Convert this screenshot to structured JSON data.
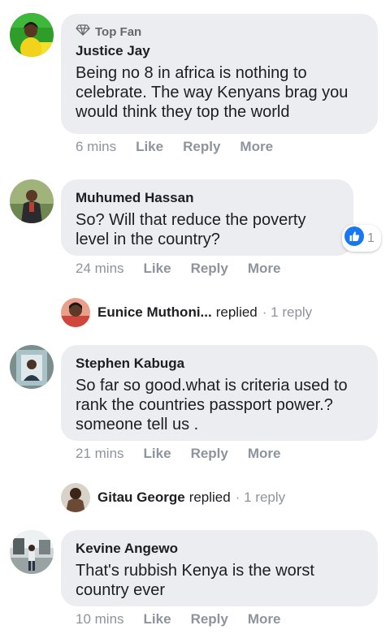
{
  "comments": [
    {
      "badge": "Top Fan",
      "name": "Justice Jay",
      "text": "Being no 8 in africa is nothing to celebrate. The way Kenyans brag you would think they top the world",
      "time": "6 mins",
      "like": "Like",
      "reply": "Reply",
      "more": "More"
    },
    {
      "name": "Muhumed Hassan",
      "text": "So? Will that reduce the poverty level in the country?",
      "time": "24 mins",
      "like": "Like",
      "reply": "Reply",
      "more": "More",
      "reaction_count": "1",
      "replied_by": "Eunice Muthoni...",
      "replied_word": "replied",
      "reply_count": "· 1 reply"
    },
    {
      "name": "Stephen Kabuga",
      "text": "So far so good.what is criteria used to rank the countries passport power.? someone tell us .",
      "time": "21 mins",
      "like": "Like",
      "reply": "Reply",
      "more": "More",
      "replied_by": "Gitau George",
      "replied_word": "replied",
      "reply_count": "· 1 reply"
    },
    {
      "name": "Kevine Angewo",
      "text": "That's rubbish Kenya is the worst country ever",
      "time": "10 mins",
      "like": "Like",
      "reply": "Reply",
      "more": "More"
    }
  ],
  "colors": {
    "bubble": "#ebedf0",
    "muted": "#8d949e",
    "like_blue": "#1877f2"
  },
  "icons": [
    "diamond-icon",
    "thumbs-up-icon"
  ]
}
